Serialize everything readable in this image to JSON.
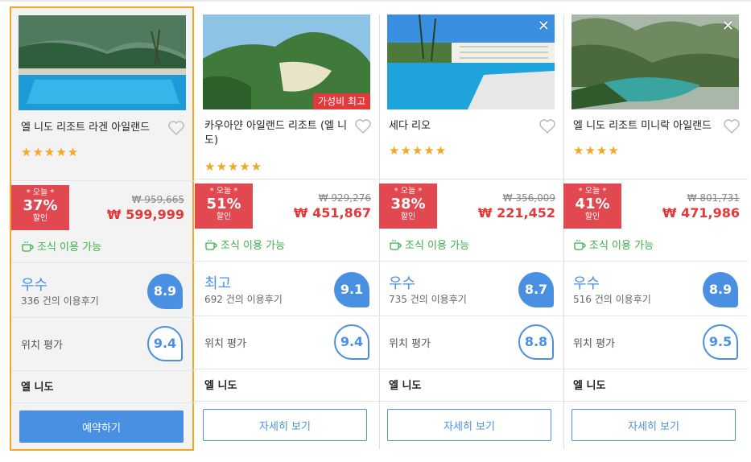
{
  "common": {
    "breakfast": "조식 이용 가능",
    "today_label": "* 오늘 *",
    "discount_label": "할인",
    "location_label": "위치 평가",
    "city": "엘 니도"
  },
  "hotels": [
    {
      "name": "엘 니도 리조트 라겐 아일랜드",
      "stars": "★★★★★",
      "discount": "37%",
      "orig_price": "₩ 959,665",
      "price": "₩ 599,999",
      "rating_text": "우수",
      "reviews": "336 건의 이용후기",
      "score": "8.9",
      "location_score": "9.4",
      "button": "예약하기",
      "badge": "",
      "selected": true
    },
    {
      "name": "카우아얀 아일랜드 리조트 (엘 니도)",
      "stars": "★★★★★",
      "discount": "51%",
      "orig_price": "₩ 929,276",
      "price": "₩ 451,867",
      "rating_text": "최고",
      "reviews": "692 건의 이용후기",
      "score": "9.1",
      "location_score": "9.4",
      "button": "자세히 보기",
      "badge": "가성비 최고"
    },
    {
      "name": "세다 리오",
      "stars": "★★★★★",
      "discount": "38%",
      "orig_price": "₩ 356,009",
      "price": "₩ 221,452",
      "rating_text": "우수",
      "reviews": "735 건의 이용후기",
      "score": "8.7",
      "location_score": "8.8",
      "button": "자세히 보기",
      "badge": ""
    },
    {
      "name": "엘 니도 리조트 미니락 아일랜드",
      "stars": "★★★★",
      "discount": "41%",
      "orig_price": "₩ 801,731",
      "price": "₩ 471,986",
      "rating_text": "우수",
      "reviews": "516 건의 이용후기",
      "score": "8.9",
      "location_score": "9.5",
      "button": "자세히 보기",
      "badge": ""
    }
  ],
  "icons": {
    "close": "close-icon",
    "heart": "heart-icon",
    "breakfast": "coffee-cup-icon"
  },
  "colors": {
    "accent": "#4a90e2",
    "discount": "#e2484f",
    "price": "#e2393a",
    "breakfast": "#3bb14a",
    "selection": "#f5a623",
    "stars": "#f5a623"
  }
}
